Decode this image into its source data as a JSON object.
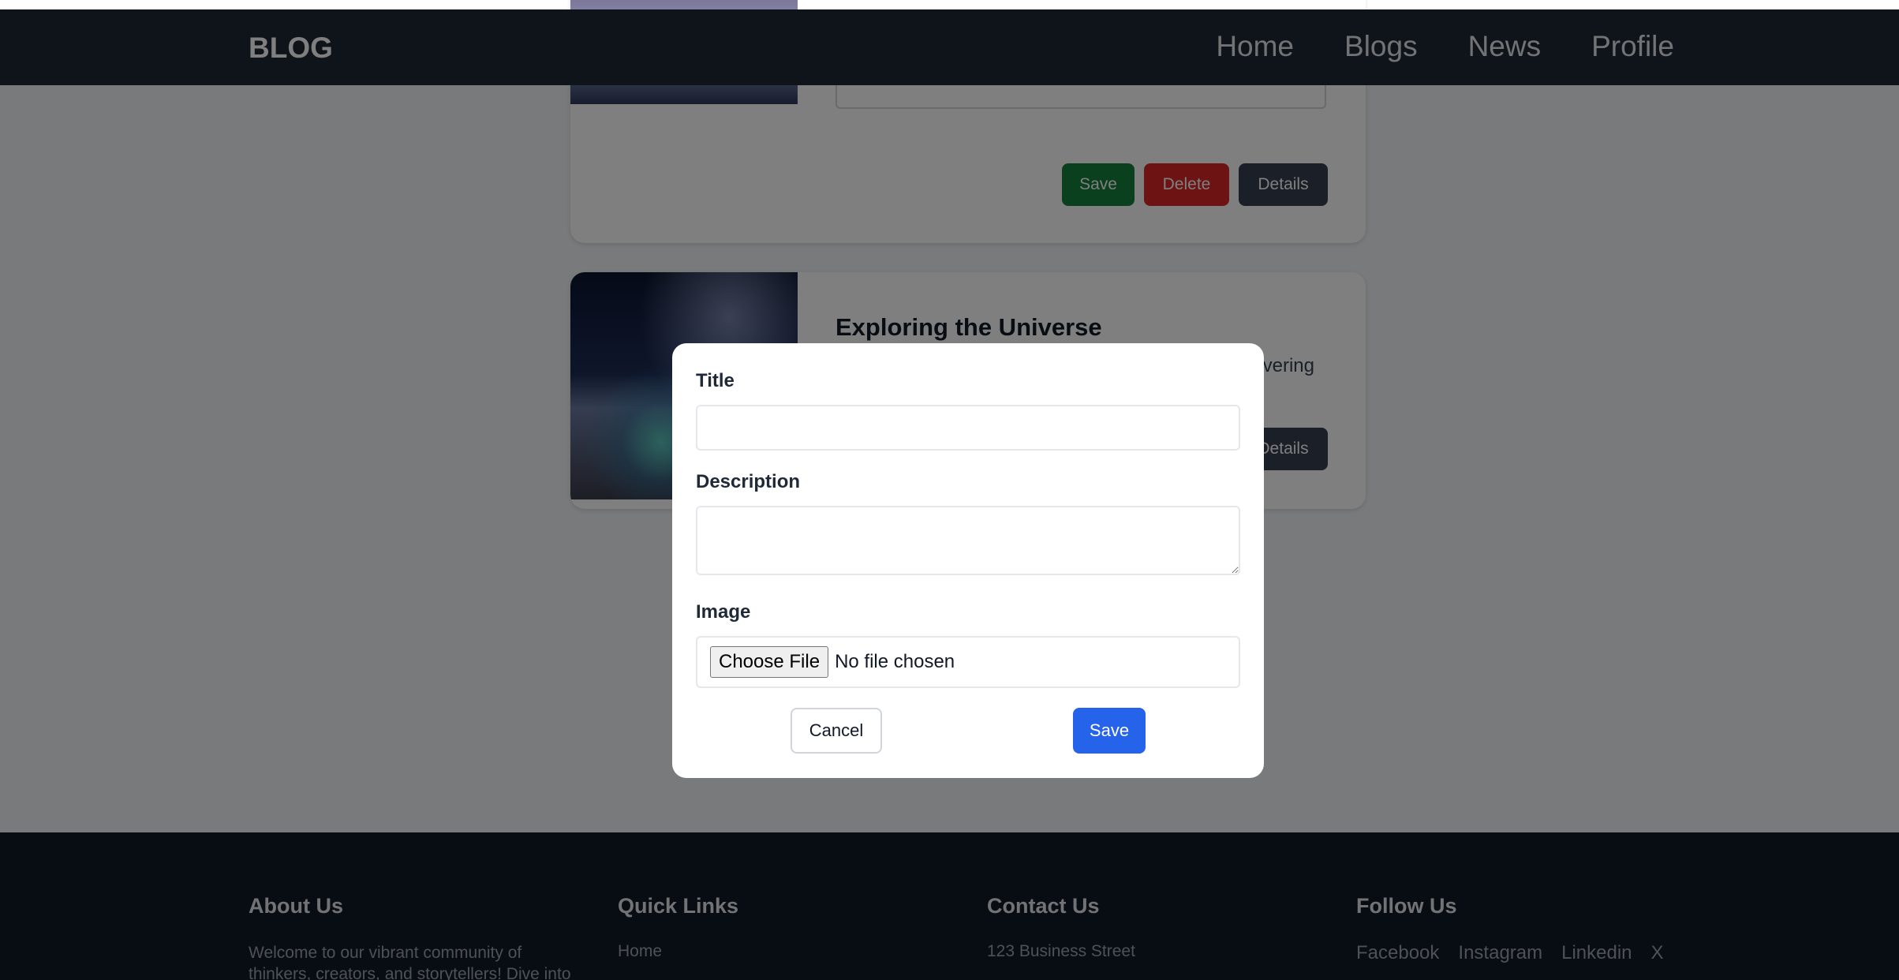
{
  "navbar": {
    "brand": "BLOG",
    "links": [
      "Home",
      "Blogs",
      "News",
      "Profile"
    ]
  },
  "cards": [
    {
      "buttons": {
        "save": "Save",
        "delete": "Delete",
        "details": "Details"
      }
    },
    {
      "title": "Exploring the Universe",
      "description_visible": "vering",
      "buttons": {
        "details": "Details"
      }
    }
  ],
  "modal": {
    "title_label": "Title",
    "title_value": "",
    "description_label": "Description",
    "description_value": "",
    "image_label": "Image",
    "choose_file_label": "Choose File",
    "file_status": "No file chosen",
    "cancel_label": "Cancel",
    "save_label": "Save"
  },
  "footer": {
    "about": {
      "heading": "About Us",
      "text": "Welcome to our vibrant community of thinkers, creators, and storytellers! Dive into"
    },
    "quick_links": {
      "heading": "Quick Links",
      "items": [
        "Home"
      ]
    },
    "contact": {
      "heading": "Contact Us",
      "address": "123 Business Street"
    },
    "follow": {
      "heading": "Follow Us",
      "links": [
        "Facebook",
        "Instagram",
        "Linkedin",
        "X"
      ]
    }
  },
  "colors": {
    "navbar_bg": "#1f2937",
    "footer_bg": "#111827",
    "primary_blue": "#2563eb",
    "save_green": "#15803d",
    "delete_red": "#dc2626",
    "details_dark": "#374151"
  }
}
